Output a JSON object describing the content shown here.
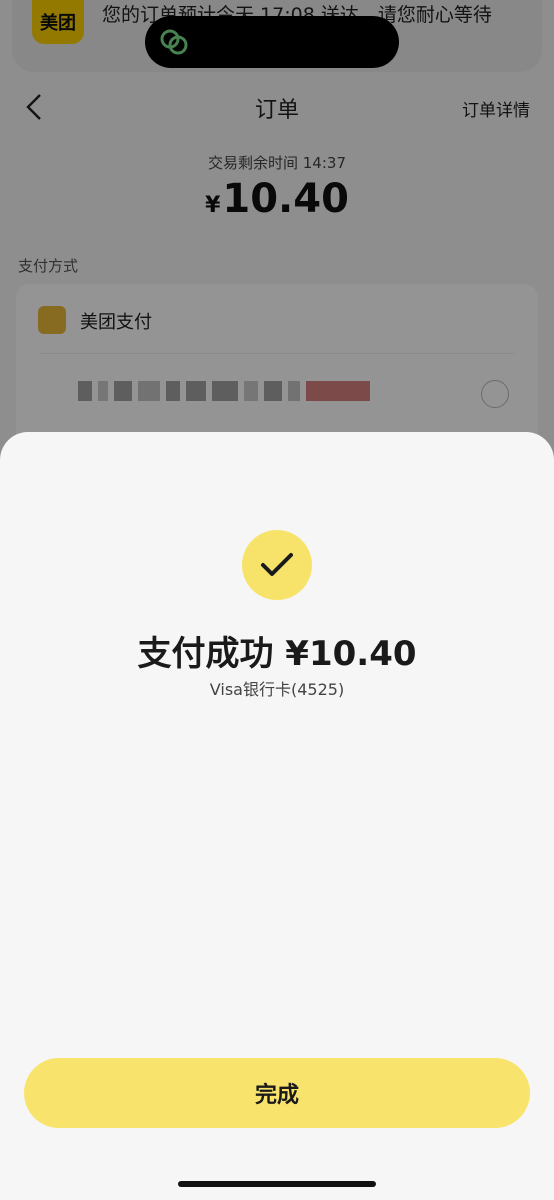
{
  "notification": {
    "app_name": "美团",
    "message": "您的订单预计今天 17:08 送达，请您耐心等待"
  },
  "header": {
    "title": "订单",
    "detail_link": "订单详情"
  },
  "order": {
    "remaining_time_text": "交易剩余时间 14:37",
    "currency": "¥",
    "amount": "10.40"
  },
  "payment_methods": {
    "section_label": "支付方式",
    "meituan_pay_label": "美团支付"
  },
  "success_sheet": {
    "title": "支付成功 ¥10.40",
    "subtitle": "Visa银行卡(4525)",
    "done_label": "完成"
  },
  "colors": {
    "brand_yellow": "#ffd100",
    "button_yellow": "#f8e46c",
    "check_yellow": "#f7e36a"
  }
}
